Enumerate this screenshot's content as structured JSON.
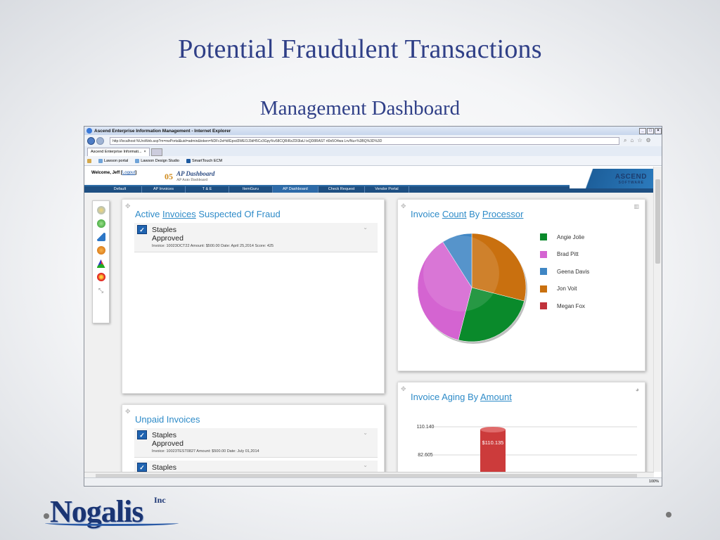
{
  "slide": {
    "title": "Potential Fraudulent Transactions",
    "subtitle": "Management Dashboard",
    "logo_text": "Nogalis",
    "logo_suffix": "Inc"
  },
  "browser": {
    "window_title": "Ascend Enterprise Information Management - Internet Explorer",
    "url": "http://localhost:%UrsWeb.asp?m=nwPortal&uid=admin&token=NDFc2eHdlGpxd3WEOJ3dH5Cz3Gpy%v58CQRiRzZDl3laU ixQD8RAST rt0o5O4wa Lrv/Nu+%3BQ%3D%3D",
    "tab_label": "Ascend Enterprise Informati...",
    "favorites": [
      "Lawson portal",
      "Lawson Design Studio",
      "SmartTouch ECM"
    ],
    "zoom": "100%"
  },
  "app": {
    "welcome": "Welcome, Jeff [",
    "logout": "Logout",
    "welcome_end": "]",
    "dashboard_number": "05",
    "dashboard_title": "AP Dashboard",
    "dashboard_subtitle": "AP Auto Dashboard",
    "logo_main": "ASCEND",
    "logo_sub": "SOFTWARE",
    "menu": [
      "Default",
      "AP Invoices",
      "T & E",
      "ItemGuru",
      "AP Dashboard",
      "Check Request",
      "Vendor Portal"
    ],
    "active_menu_index": 4
  },
  "panels": {
    "fraud": {
      "title_part1": "Active ",
      "title_link": "Invoices",
      "title_part2": " Suspected Of Fraud",
      "items": [
        {
          "vendor": "Staples",
          "status": "Approved",
          "details": "Invoice: 10023OCT22   Amount: $500.00   Date: April 25,2014   Score: 425"
        }
      ]
    },
    "unpaid": {
      "title": "Unpaid Invoices",
      "items": [
        {
          "vendor": "Staples",
          "status": "Approved",
          "details": "Invoice: 10023TEST0827   Amount: $500.00   Date: July 01,2014"
        },
        {
          "vendor": "Staples",
          "status": "",
          "details": ""
        }
      ]
    },
    "count": {
      "title_part1": "Invoice ",
      "title_link1": "Count",
      "title_part2": " By ",
      "title_link2": "Processor"
    },
    "aging": {
      "title_part1": "Invoice Aging By ",
      "title_link": "Amount"
    }
  },
  "chart_data": [
    {
      "type": "pie",
      "title": "Invoice Count By Processor",
      "series": [
        {
          "name": "Angie Jolie",
          "value": 25,
          "color": "#0a8a2b"
        },
        {
          "name": "Brad Pitt",
          "value": 37,
          "color": "#d464d1"
        },
        {
          "name": "Geena Davis",
          "value": 9,
          "color": "#3f86c4"
        },
        {
          "name": "Jon Voit",
          "value": 29,
          "color": "#c9700f"
        },
        {
          "name": "Megan Fox",
          "value": 0,
          "color": "#c0323b"
        }
      ]
    },
    {
      "type": "bar",
      "title": "Invoice Aging By Amount",
      "ticks": [
        "110.140",
        "82.605"
      ],
      "bar_label": "$110.135",
      "bar_value": 110.135,
      "bar_color": "#cc3b3b"
    }
  ]
}
